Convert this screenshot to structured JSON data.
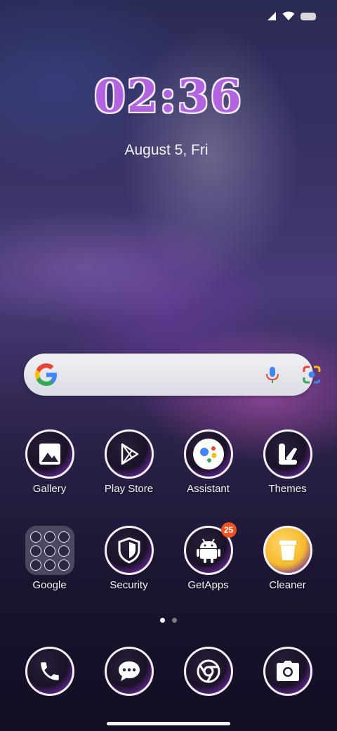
{
  "clock": {
    "time": "02:36",
    "date": "August 5, Fri"
  },
  "search": {
    "engine_icon": "google-g-icon",
    "mic_icon": "mic-icon",
    "lens_icon": "lens-icon"
  },
  "apps_row1": [
    {
      "label": "Gallery",
      "icon": "image-icon"
    },
    {
      "label": "Play Store",
      "icon": "play-store-icon"
    },
    {
      "label": "Assistant",
      "icon": "assistant-icon"
    },
    {
      "label": "Themes",
      "icon": "themes-icon"
    }
  ],
  "apps_row2": [
    {
      "label": "Google",
      "icon": "folder-icon"
    },
    {
      "label": "Security",
      "icon": "shield-icon"
    },
    {
      "label": "GetApps",
      "icon": "android-icon",
      "badge": "25"
    },
    {
      "label": "Cleaner",
      "icon": "trash-bin-icon"
    }
  ],
  "dock": [
    {
      "icon": "phone-icon"
    },
    {
      "icon": "messages-icon"
    },
    {
      "icon": "chrome-icon"
    },
    {
      "icon": "camera-icon"
    }
  ],
  "colors": {
    "badge": "#f0521e",
    "clock": "#b163e0"
  }
}
